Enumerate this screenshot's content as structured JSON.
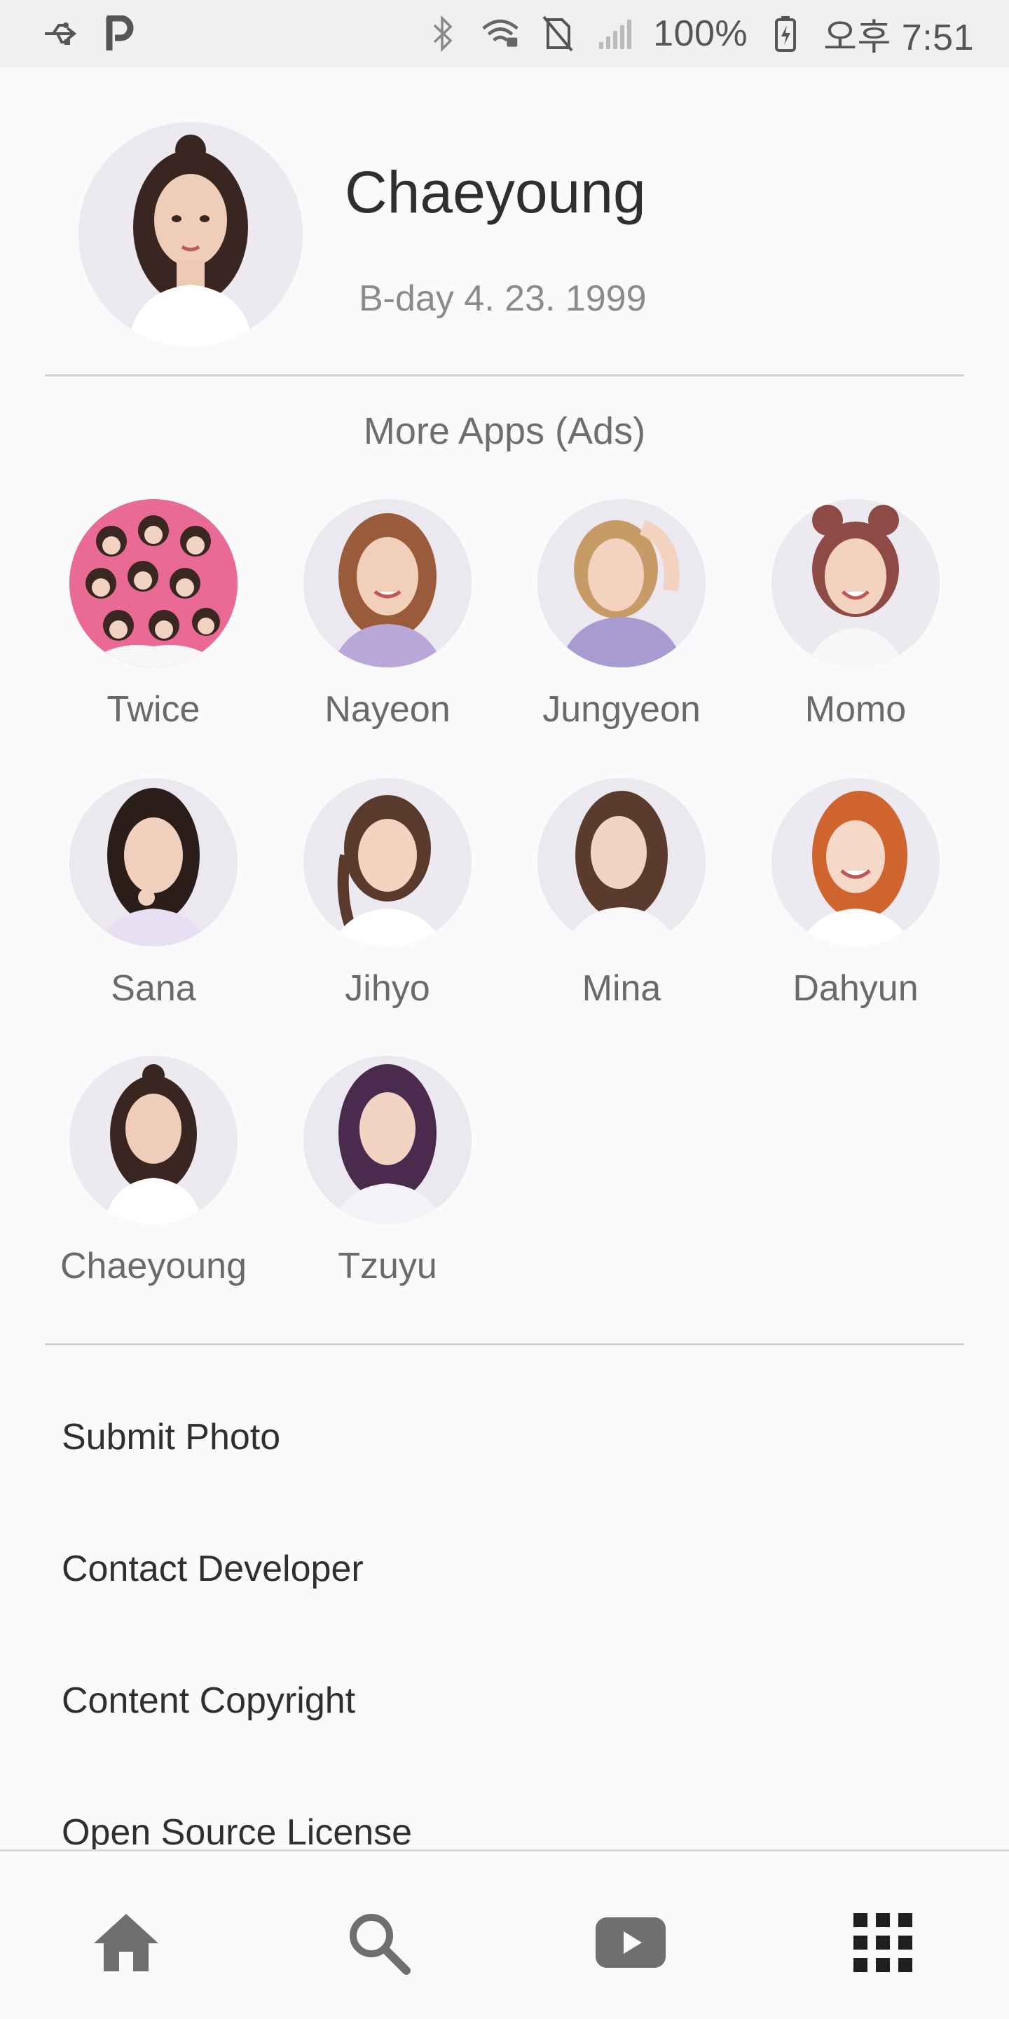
{
  "status_bar": {
    "battery": "100%",
    "time": "오후 7:51",
    "icons": [
      "usb-icon",
      "p-icon",
      "bluetooth-icon",
      "wifi-icon",
      "no-sim-icon",
      "signal-icon",
      "battery-icon"
    ]
  },
  "profile": {
    "name": "Chaeyoung",
    "birthday": "B-day 4. 23. 1999"
  },
  "more_apps": {
    "title": "More Apps (Ads)",
    "apps": [
      {
        "label": "Twice"
      },
      {
        "label": "Nayeon"
      },
      {
        "label": "Jungyeon"
      },
      {
        "label": "Momo"
      },
      {
        "label": "Sana"
      },
      {
        "label": "Jihyo"
      },
      {
        "label": "Mina"
      },
      {
        "label": "Dahyun"
      },
      {
        "label": "Chaeyoung"
      },
      {
        "label": "Tzuyu"
      }
    ]
  },
  "menu": {
    "items": [
      {
        "label": "Submit Photo"
      },
      {
        "label": "Contact Developer"
      },
      {
        "label": "Content Copyright"
      },
      {
        "label": "Open Source License"
      }
    ]
  },
  "bottom_nav": {
    "items": [
      "home-icon",
      "search-icon",
      "youtube-icon",
      "apps-grid-icon"
    ]
  },
  "colors": {
    "status_bar_bg": "#f0eff2",
    "page_bg": "#fafafa",
    "divider": "#cfcfcf",
    "icon_gray": "#6f6f6f"
  }
}
